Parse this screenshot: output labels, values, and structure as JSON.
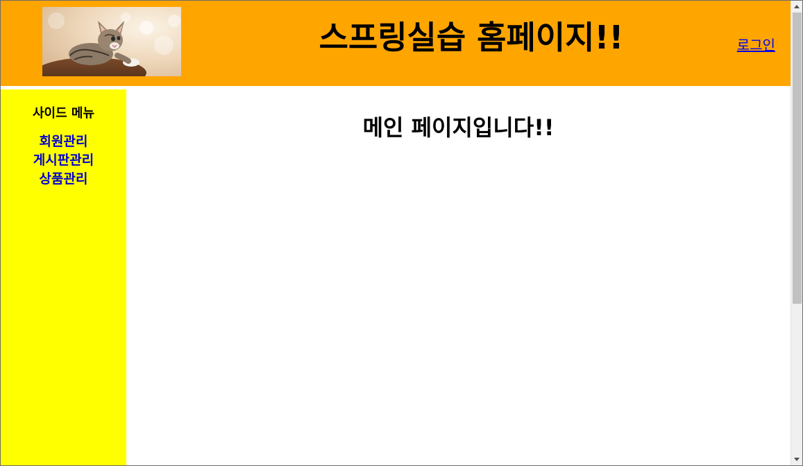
{
  "header": {
    "title": "스프링실습 홈페이지!!",
    "login_label": "로그인",
    "logo_icon": "cat-photo-logo",
    "background_color": "#ffa500"
  },
  "sidebar": {
    "title": "사이드 메뉴",
    "background_color": "#ffff00",
    "items": [
      {
        "label": "회원관리"
      },
      {
        "label": "게시판관리"
      },
      {
        "label": "상품관리"
      }
    ]
  },
  "main": {
    "heading": "메인 페이지입니다!!"
  },
  "colors": {
    "link": "#0000ee",
    "menu_link": "#0000cc"
  }
}
